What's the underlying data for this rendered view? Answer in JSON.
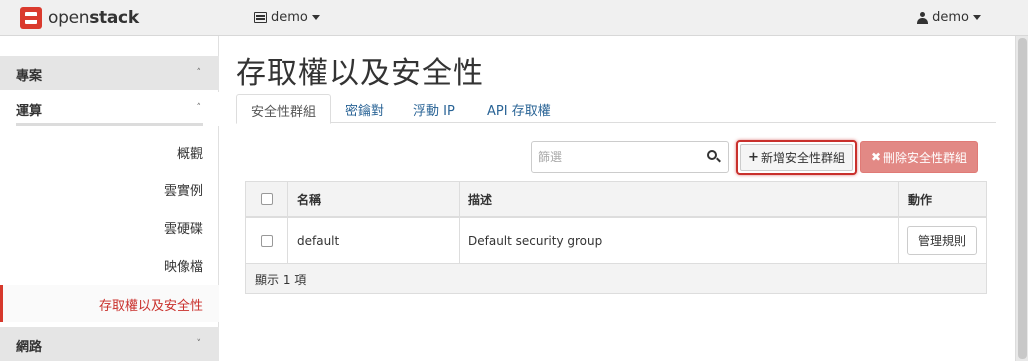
{
  "navbar": {
    "logo_text_regular": "open",
    "logo_text_bold": "stack",
    "project": "demo",
    "user": "demo"
  },
  "sidebar": {
    "section_project": "專案",
    "subsection_compute": "運算",
    "items": [
      {
        "label": "概觀"
      },
      {
        "label": "雲實例"
      },
      {
        "label": "雲硬碟"
      },
      {
        "label": "映像檔"
      },
      {
        "label": "存取權以及安全性",
        "active": true
      }
    ],
    "section_network": "網路"
  },
  "main": {
    "title": "存取權以及安全性",
    "tabs": [
      {
        "label": "安全性群組",
        "active": true
      },
      {
        "label": "密鑰對"
      },
      {
        "label": "浮動 IP"
      },
      {
        "label": "API 存取權"
      }
    ],
    "filter_placeholder": "篩選",
    "add_button": "新增安全性群組",
    "delete_button": "刪除安全性群組"
  },
  "table": {
    "headers": [
      "名稱",
      "描述",
      "動作"
    ],
    "rows": [
      {
        "name": "default",
        "description": "Default security group",
        "action": "管理規則"
      }
    ],
    "footer": "顯示 1 項"
  },
  "colors": {
    "accent_red": "#c9302c",
    "link_blue": "#2a6496",
    "danger_button": "#e28985"
  },
  "icons": [
    "logo-icon",
    "project-icon",
    "caret-icon",
    "user-icon",
    "chevron-up-icon",
    "chevron-down-icon",
    "search-icon",
    "plus-icon",
    "times-icon"
  ]
}
